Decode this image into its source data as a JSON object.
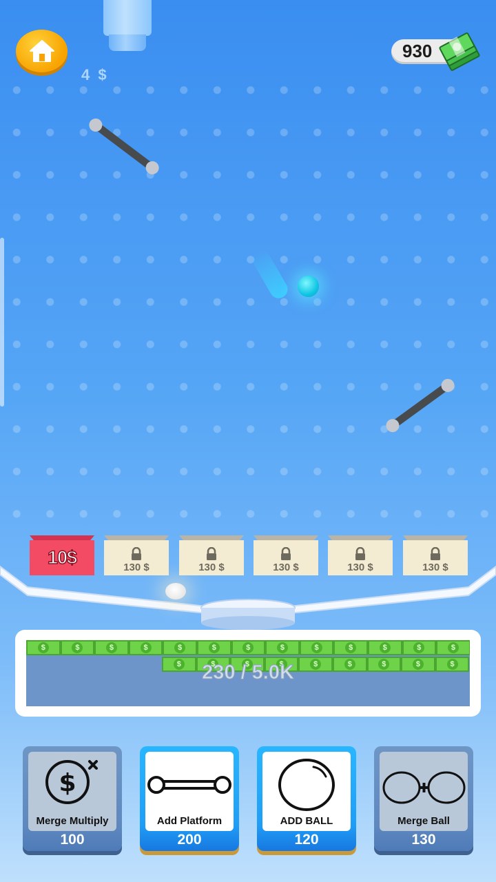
{
  "hud": {
    "rate_label": "4 $",
    "money_amount": "930"
  },
  "shelves": [
    {
      "label": "10$",
      "locked": false
    },
    {
      "label": "130 $",
      "locked": true
    },
    {
      "label": "130 $",
      "locked": true
    },
    {
      "label": "130 $",
      "locked": true
    },
    {
      "label": "130 $",
      "locked": true
    },
    {
      "label": "130 $",
      "locked": true
    }
  ],
  "tank": {
    "progress_label": "230 / 5.0K",
    "progress_fraction": 0.046,
    "bill_symbol": "$"
  },
  "upgrades": [
    {
      "label": "Merge Multiply",
      "cost": "100",
      "enabled": false
    },
    {
      "label": "Add Platform",
      "cost": "200",
      "enabled": true
    },
    {
      "label": "ADD BALL",
      "cost": "120",
      "enabled": true
    },
    {
      "label": "Merge Ball",
      "cost": "130",
      "enabled": false
    }
  ],
  "colors": {
    "sky_top": "#3a8ef0",
    "sky_bottom": "#bfe0fc",
    "home_button": "#f8a300",
    "unlocked_shelf": "#f24b63",
    "locked_shelf": "#f4ecd2",
    "bill_green": "#6fd34a",
    "ball_cyan": "#11c6e3",
    "card_active": "#1f9ef7",
    "card_disabled": "#6e96c5"
  },
  "icons": {
    "home": "house-icon",
    "money": "cash-stack-icon",
    "lock": "padlock-icon"
  }
}
